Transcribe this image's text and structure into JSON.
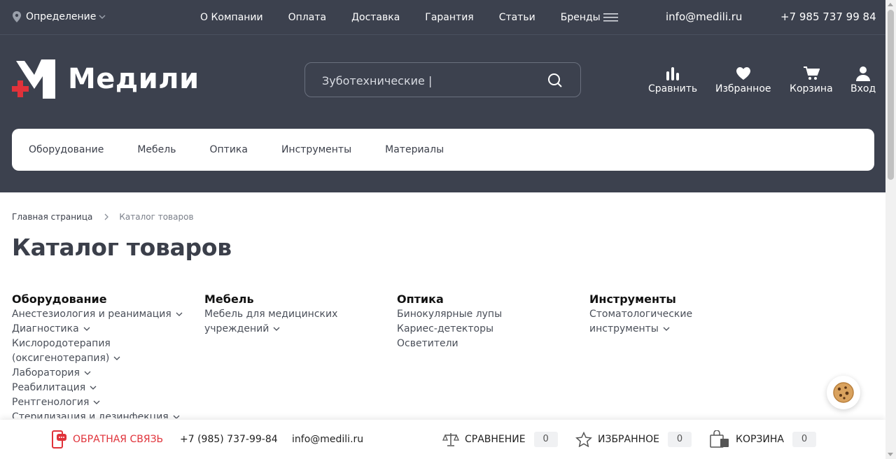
{
  "topbar": {
    "location": "Определение",
    "nav": [
      "О Компании",
      "Оплата",
      "Доставка",
      "Гарантия",
      "Статьи",
      "Бренды"
    ],
    "email": "info@medili.ru",
    "phone": "+7 985 737 99 84"
  },
  "header": {
    "logo_text": "Медили",
    "search_value": "Зуботехнические |",
    "icons": [
      {
        "label": "Сравнить",
        "icon": "compare-icon"
      },
      {
        "label": "Избранное",
        "icon": "heart-icon"
      },
      {
        "label": "Корзина",
        "icon": "cart-icon"
      },
      {
        "label": "Вход",
        "icon": "user-icon"
      }
    ]
  },
  "catnav": [
    "Оборудование",
    "Мебель",
    "Оптика",
    "Инструменты",
    "Материалы"
  ],
  "breadcrumb": {
    "home": "Главная страница",
    "current": "Каталог товаров"
  },
  "page_title": "Каталог товаров",
  "catalog": {
    "columns": [
      {
        "title": "Оборудование",
        "items": [
          "Анестезиология и реанимация",
          "Диагностика",
          "Кислородотерапия (оксигенотерапия)",
          "Лаборатория",
          "Реабилитация",
          "Рентгенология",
          "Стерилизация и дезинфекция"
        ]
      },
      {
        "title": "Мебель",
        "items": [
          "Мебель для медицинских учреждений"
        ]
      },
      {
        "title": "Оптика",
        "items": [
          "Бинокулярные лупы",
          "Кариес-детекторы",
          "Осветители"
        ]
      },
      {
        "title": "Инструменты",
        "items": [
          "Стоматологические инструменты"
        ]
      }
    ]
  },
  "bottombar": {
    "feedback": "ОБРАТНАЯ СВЯЗЬ",
    "phone": "+7 (985) 737-99-84",
    "email": "info@medili.ru",
    "compare": {
      "label": "СРАВНЕНИЕ",
      "count": "0"
    },
    "favorites": {
      "label": "ИЗБРАННОЕ",
      "count": "0"
    },
    "cart": {
      "label": "КОРЗИНА",
      "count": "0"
    }
  },
  "colors": {
    "dark": "#3c414e",
    "accent": "#e0323a",
    "text": "#3b3f4a"
  }
}
